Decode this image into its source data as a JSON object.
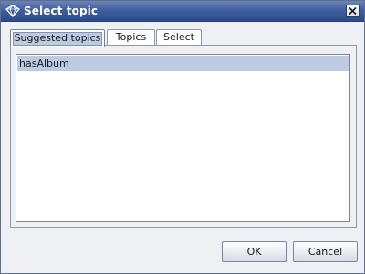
{
  "window": {
    "title": "Select topic",
    "icon": "topic-map-icon",
    "close_icon": "close-icon"
  },
  "tabs": [
    {
      "label": "Suggested topics",
      "active": true
    },
    {
      "label": "Topics",
      "active": false
    },
    {
      "label": "Select",
      "active": false
    }
  ],
  "list": {
    "items": [
      {
        "label": "hasAlbum",
        "selected": true
      }
    ]
  },
  "buttons": {
    "ok_label": "OK",
    "cancel_label": "Cancel"
  },
  "colors": {
    "titlebar": "#3f5f9f",
    "selection": "#bccbe2",
    "background": "#eef0f4"
  }
}
